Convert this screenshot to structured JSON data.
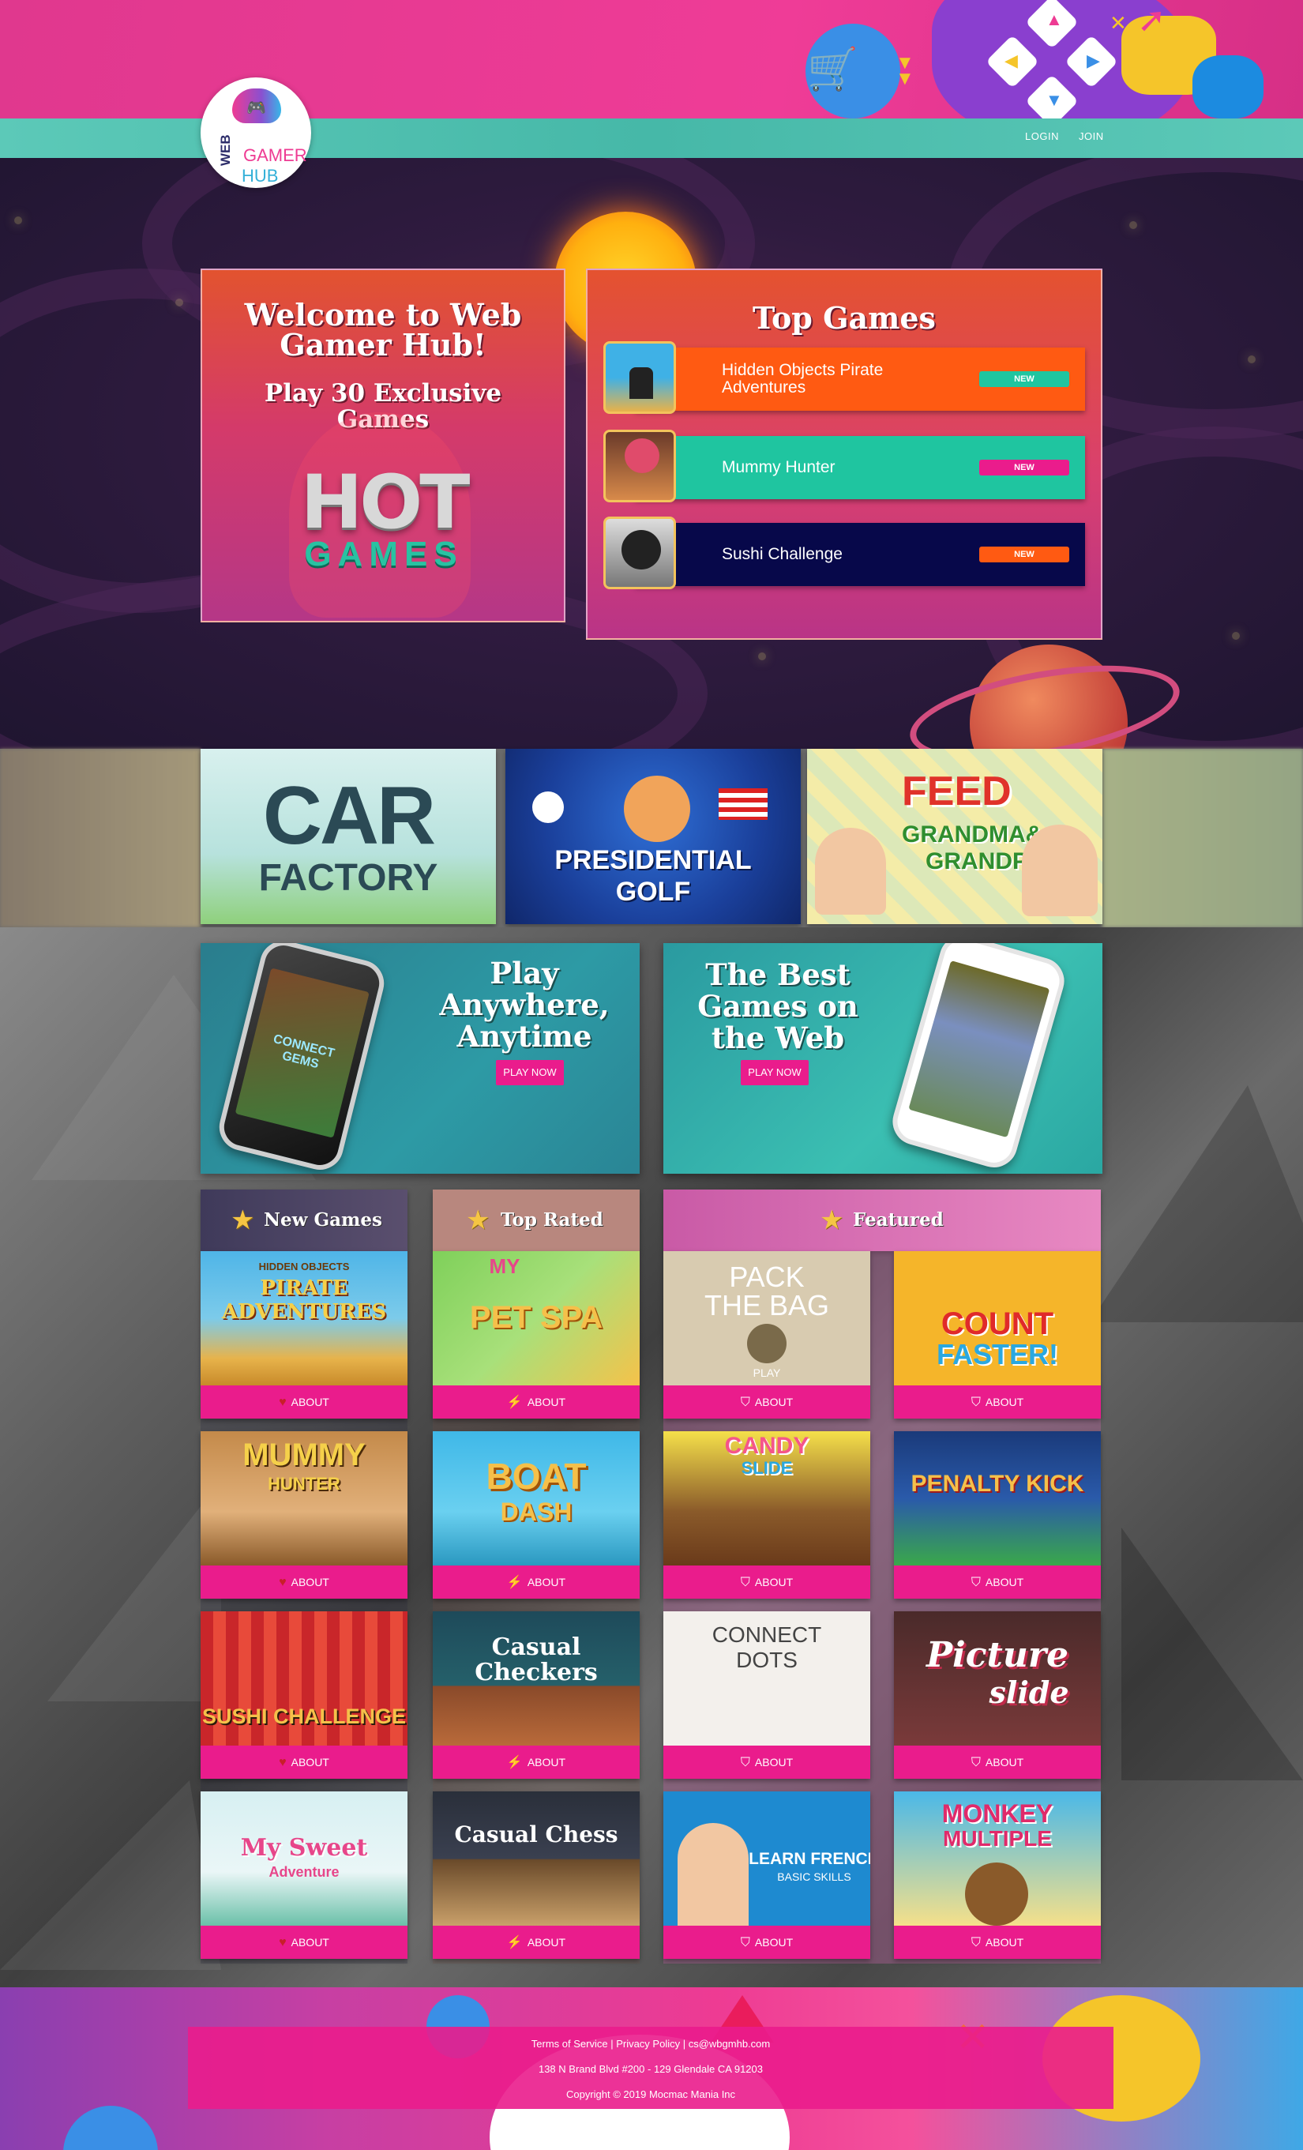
{
  "colors": {
    "pink": "#ea1c8c",
    "teal": "#1fc5a0",
    "navy": "#07084a",
    "orange": "#ff5a1a",
    "header_pink": "#ef3c97",
    "header_teal": "#5cc9b8"
  },
  "logo": {
    "line1": "WEB",
    "line2": "GAMER",
    "line3": "HUB"
  },
  "nav": {
    "login": "LOGIN",
    "join": "JOIN"
  },
  "welcome": {
    "title": "Welcome to Web Gamer Hub!",
    "subtitle": "Play 30 Exclusive Games",
    "logo_top": "HOT",
    "logo_bottom": "GAMES"
  },
  "top_games": {
    "title": "Top Games",
    "items": [
      {
        "name": "Hidden Objects Pirate Adventures",
        "badge": "NEW",
        "bar_color": "#ff5a12",
        "badge_color": "#1fc5a0"
      },
      {
        "name": "Mummy Hunter",
        "badge": "NEW",
        "bar_color": "#1fc5a0",
        "badge_color": "#ea1c8c"
      },
      {
        "name": "Sushi Challenge",
        "badge": "NEW",
        "bar_color": "#07084a",
        "badge_color": "#ff5a12"
      }
    ]
  },
  "featured_tiles": [
    {
      "line1": "CAR",
      "line2": "FACTORY"
    },
    {
      "line1": "PRESIDENTIAL",
      "line2": "GOLF"
    },
    {
      "line1": "FEED",
      "line2": "GRANDMA&",
      "line3": "GRANDPA"
    }
  ],
  "promos": [
    {
      "text": "Play Anywhere, Anytime",
      "button": "PLAY NOW",
      "screen_text": "CONNECT GEMS"
    },
    {
      "text": "The Best Games on the Web",
      "button": "PLAY NOW"
    }
  ],
  "columns": {
    "new_games": {
      "title": "New Games",
      "about_icon": "heart-icon",
      "items": [
        {
          "title": "PIRATE ADVENTURES",
          "subtitle": "HIDDEN OBJECTS",
          "about": "ABOUT"
        },
        {
          "title": "MUMMY",
          "subtitle": "HUNTER",
          "about": "ABOUT"
        },
        {
          "title": "SUSHI CHALLENGE",
          "about": "ABOUT"
        },
        {
          "title": "My Sweet",
          "subtitle": "Adventure",
          "about": "ABOUT"
        }
      ]
    },
    "top_rated": {
      "title": "Top Rated",
      "about_icon": "lightning-icon",
      "items": [
        {
          "title": "MY",
          "subtitle": "PET SPA",
          "about": "ABOUT"
        },
        {
          "title": "BOAT",
          "subtitle": "DASH",
          "about": "ABOUT"
        },
        {
          "title": "Casual",
          "subtitle": "Checkers",
          "about": "ABOUT"
        },
        {
          "title": "Casual Chess",
          "about": "ABOUT"
        }
      ]
    },
    "featured": {
      "title": "Featured",
      "about_icon": "shield-icon",
      "items": [
        {
          "title": "PACK",
          "subtitle": "THE BAG",
          "caption": "PLAY",
          "about": "ABOUT"
        },
        {
          "title": "COUNT",
          "subtitle": "FASTER!",
          "about": "ABOUT"
        },
        {
          "title": "CANDY",
          "subtitle": "SLIDE",
          "about": "ABOUT"
        },
        {
          "title": "PENALTY KICK",
          "about": "ABOUT"
        },
        {
          "title": "CONNECT",
          "subtitle": "DOTS",
          "about": "ABOUT"
        },
        {
          "title": "Picture",
          "subtitle": "slide",
          "about": "ABOUT"
        },
        {
          "title": "LEARN FRENCH",
          "subtitle": "BASIC SKILLS",
          "about": "ABOUT"
        },
        {
          "title": "MONKEY",
          "subtitle": "MULTIPLE",
          "about": "ABOUT"
        }
      ]
    }
  },
  "footer": {
    "terms": "Terms of Service",
    "sep1": " | ",
    "privacy": "Privacy Policy",
    "sep2": " | ",
    "email": "cs@wbgmhb.com",
    "address": "138 N Brand Blvd #200 - 129 Glendale CA 91203",
    "copyright": "Copyright © 2019 Mocmac Mania Inc"
  }
}
